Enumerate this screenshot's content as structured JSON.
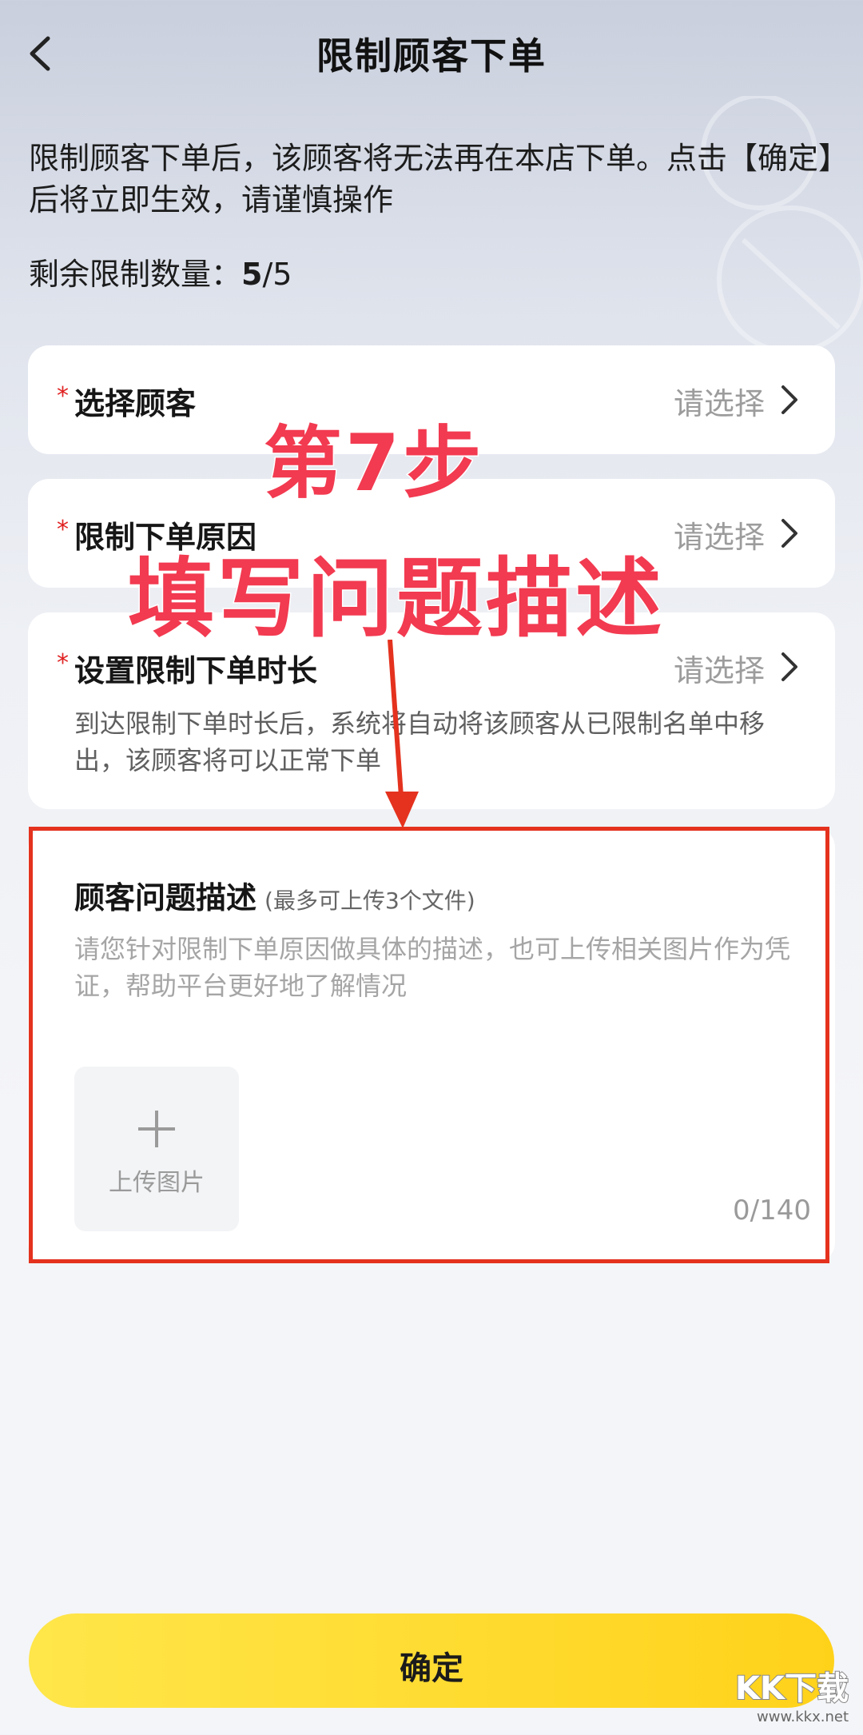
{
  "header": {
    "title": "限制顾客下单"
  },
  "notice": {
    "text": "限制顾客下单后，该顾客将无法再在本店下单。点击【确定】后将立即生效，请谨慎操作"
  },
  "remaining": {
    "label": "剩余限制数量：",
    "used": "5",
    "separator": "/",
    "total": "5"
  },
  "rows": [
    {
      "required_mark": "*",
      "label": "选择顾客",
      "value": "请选择"
    },
    {
      "required_mark": "*",
      "label": "限制下单原因",
      "value": "请选择"
    },
    {
      "required_mark": "*",
      "label": "设置限制下单时长",
      "value": "请选择",
      "note": "到达限制下单时长后，系统将自动将该顾客从已限制名单中移出，该顾客将可以正常下单"
    }
  ],
  "description": {
    "title": "顾客问题描述",
    "subtitle": "(最多可上传3个文件)",
    "placeholder": "请您针对限制下单原因做具体的描述，也可上传相关图片作为凭证，帮助平台更好地了解情况",
    "upload_label": "上传图片",
    "counter": "0/140"
  },
  "overlay": {
    "step": "第7步",
    "instruction": "填写问题描述"
  },
  "confirm": {
    "label": "确定"
  },
  "watermark": {
    "logo": "KK下载",
    "url": "www.kkx.net"
  },
  "colors": {
    "accent": "#ffd21a",
    "overlay_text": "#f23a50",
    "highlight_border": "#e4321e",
    "required": "#e02020"
  },
  "icons": {
    "back": "chevron-left-icon",
    "row_arrow": "chevron-right-icon",
    "upload": "plus-icon",
    "annotation_arrow": "arrow-down-icon"
  }
}
